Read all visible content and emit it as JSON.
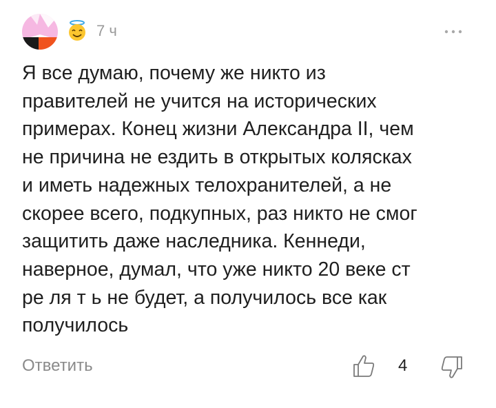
{
  "comment": {
    "author": {
      "avatar_icon": "user-avatar-image",
      "badge_icon": "angel-smiley-icon"
    },
    "time": "7 ч",
    "more_icon": "more-dots-icon",
    "text": "Я все думаю, почему же никто из\nправителей не учится на исторических\nпримерах. Конец жизни Александра II, чем\nне причина не ездить в открытых колясках\nи иметь надежных телохранителей, а не\nскорее всего, подкупных, раз никто не смог\nзащитить даже наследника. Кеннеди,\nнаверное, думал, что уже никто 20 веке ст\nре ля т ь не будет, а получилось все как\nполучилось",
    "reply_label": "Ответить",
    "like_icon": "thumbs-up-icon",
    "rating": "4",
    "dislike_icon": "thumbs-down-icon"
  }
}
